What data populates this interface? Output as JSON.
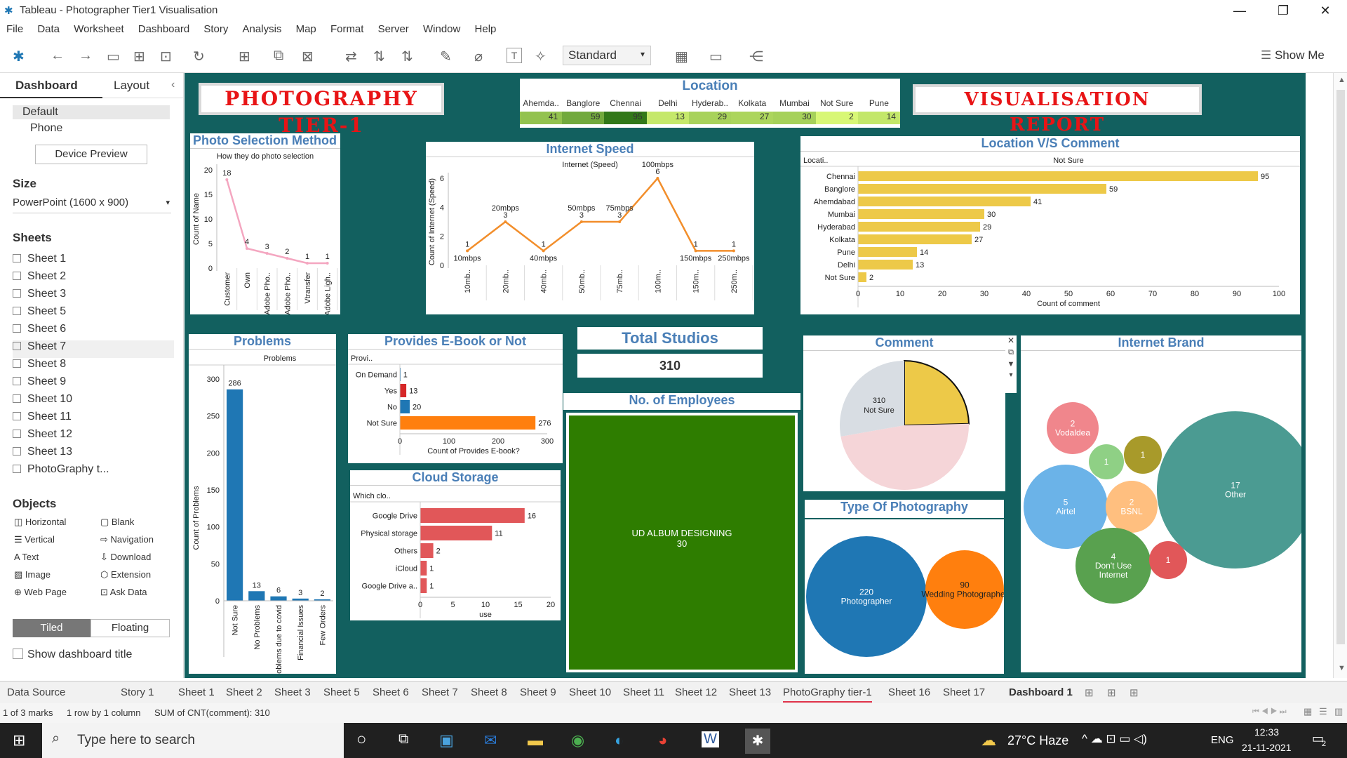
{
  "window": {
    "title": "Tableau - Photographer Tier1 Visualisation",
    "controls": [
      "—",
      "❐",
      "✕"
    ]
  },
  "menu": [
    "File",
    "Data",
    "Worksheet",
    "Dashboard",
    "Story",
    "Analysis",
    "Map",
    "Format",
    "Server",
    "Window",
    "Help"
  ],
  "toolbar": {
    "mode": "Standard",
    "show_me": "Show Me"
  },
  "left": {
    "tab_dashboard": "Dashboard",
    "tab_layout": "Layout",
    "collapse": "‹",
    "devices": [
      "Default",
      "Phone"
    ],
    "device_preview": "Device Preview",
    "size_label": "Size",
    "size_value": "PowerPoint (1600 x 900)",
    "sheets_label": "Sheets",
    "sheets": [
      "Sheet 1",
      "Sheet 2",
      "Sheet 3",
      "Sheet 5",
      "Sheet 6",
      "Sheet 7",
      "Sheet 8",
      "Sheet 9",
      "Sheet 10",
      "Sheet 11",
      "Sheet 12",
      "Sheet 13",
      "PhotoGraphy t..."
    ],
    "objects_label": "Objects",
    "objects": [
      "Horizontal",
      "Blank",
      "Vertical",
      "Navigation",
      "Text",
      "Download",
      "Image",
      "Extension",
      "Web Page",
      "Ask Data"
    ],
    "tiled": "Tiled",
    "floating": "Floating",
    "show_title": "Show dashboard title"
  },
  "dashboard": {
    "banner_left": "PHOTOGRAPHY TIER-1",
    "banner_right": "VISUALISATION REPORT",
    "location": {
      "title": "Location",
      "headers": [
        "Ahemda..",
        "Banglore",
        "Chennai",
        "Delhi",
        "Hyderab..",
        "Kolkata",
        "Mumbai",
        "Not Sure",
        "Pune"
      ],
      "values": [
        "41",
        "59",
        "95",
        "13",
        "29",
        "27",
        "30",
        "2",
        "14"
      ]
    },
    "total_studios": {
      "title": "Total Studios",
      "value": "310"
    },
    "employees": {
      "title": "No. of Employees",
      "label": "UD ALBUM DESIGNING",
      "value": "30"
    },
    "comment_panel": {
      "title": "Comment",
      "label": "Not Sure",
      "value": "310"
    },
    "type_photo": {
      "title": "Type Of Photography",
      "bubbles": [
        {
          "label": "Photographer",
          "value": "220"
        },
        {
          "label": "Wedding Photographer",
          "value": "90"
        }
      ]
    },
    "internet_brand": {
      "title": "Internet Brand",
      "bubbles": [
        {
          "label": "Vodaldea",
          "value": "2"
        },
        {
          "label": "",
          "value": "1"
        },
        {
          "label": "",
          "value": "1"
        },
        {
          "label": "Airtel",
          "value": "5"
        },
        {
          "label": "BSNL",
          "value": "2"
        },
        {
          "label": "Other",
          "value": "17"
        },
        {
          "label": "Don't Use Internet",
          "value": "4"
        },
        {
          "label": "",
          "value": "1"
        }
      ]
    }
  },
  "chart_data": [
    {
      "type": "line",
      "title": "Photo Selection Method",
      "subtitle": "How they do photo selection",
      "ylabel": "Count of Name",
      "ylim": [
        0,
        20
      ],
      "yticks": [
        0,
        5,
        10,
        15,
        20
      ],
      "categories": [
        "Customer",
        "Own",
        "Adobe Pho..",
        "Adobe Pho..",
        "Vtransfer",
        "Adobe Ligh.."
      ],
      "values": [
        18,
        4,
        3,
        2,
        1,
        1
      ],
      "color": "#f4a6c0"
    },
    {
      "type": "line",
      "title": "Internet Speed",
      "subtitle": "Internet (Speed)",
      "ylabel": "Count of Internet (Speed)",
      "ylim": [
        0,
        6
      ],
      "yticks": [
        0,
        2,
        4,
        6
      ],
      "categories": [
        "10mb..",
        "20mb..",
        "40mb..",
        "50mb..",
        "75mb..",
        "100m..",
        "150m..",
        "250m.."
      ],
      "point_labels": [
        "10mbps",
        "20mbps",
        "40mbps",
        "50mbps",
        "75mbps",
        "100mbps",
        "150mbps",
        "250mbps"
      ],
      "values": [
        1,
        3,
        1,
        3,
        3,
        6,
        1,
        1
      ],
      "color": "#f28e2b"
    },
    {
      "type": "bar",
      "orientation": "horizontal",
      "title": "Location V/S Comment",
      "column_header": "Not Sure",
      "row_header": "Locati..",
      "xlabel": "Count of comment",
      "xlim": [
        0,
        100
      ],
      "xticks": [
        0,
        10,
        20,
        30,
        40,
        50,
        60,
        70,
        80,
        90,
        100
      ],
      "categories": [
        "Chennai",
        "Banglore",
        "Ahemdabad",
        "Mumbai",
        "Hyderabad",
        "Kolkata",
        "Pune",
        "Delhi",
        "Not Sure"
      ],
      "values": [
        95,
        59,
        41,
        30,
        29,
        27,
        14,
        13,
        2
      ],
      "color": "#edc948"
    },
    {
      "type": "bar",
      "title": "Problems",
      "column_header": "Problems",
      "ylabel": "Count of Problems",
      "ylim": [
        0,
        300
      ],
      "yticks": [
        0,
        50,
        100,
        150,
        200,
        250,
        300
      ],
      "categories": [
        "Not Sure",
        "No Problems",
        "Problems due to covid",
        "Financial Issues",
        "Few Orders"
      ],
      "values": [
        286,
        13,
        6,
        3,
        2
      ],
      "color": "#1f77b4"
    },
    {
      "type": "bar",
      "orientation": "horizontal",
      "title": "Provides E-Book or Not",
      "row_header": "Provi..",
      "xlabel": "Count of Provides E-book?",
      "xlim": [
        0,
        300
      ],
      "xticks": [
        0,
        100,
        200,
        300
      ],
      "categories": [
        "On Demand",
        "Yes",
        "No",
        "Not Sure"
      ],
      "values": [
        1,
        13,
        20,
        276
      ],
      "colors": [
        "#1f77b4",
        "#d62728",
        "#1f77b4",
        "#ff7f0e"
      ]
    },
    {
      "type": "bar",
      "orientation": "horizontal",
      "title": "Cloud Storage",
      "row_header": "Which clo..",
      "xlabel": "use",
      "xlim": [
        0,
        20
      ],
      "xticks": [
        0,
        5,
        10,
        15,
        20
      ],
      "categories": [
        "Google Drive",
        "Physical storage",
        "Others",
        "iCloud",
        "Google Drive a.."
      ],
      "values": [
        16,
        11,
        2,
        1,
        1
      ],
      "color": "#e15759"
    },
    {
      "type": "pie",
      "title": "Comment",
      "categories": [
        "Not Sure",
        "",
        ""
      ],
      "values": [
        310,
        600,
        350
      ],
      "colors": [
        "#edc948",
        "#f5d5d8",
        "#d8dde3"
      ]
    }
  ],
  "bottom_tabs": [
    "Data Source",
    "Story 1",
    "Sheet 1",
    "Sheet 2",
    "Sheet 3",
    "Sheet 5",
    "Sheet 6",
    "Sheet 7",
    "Sheet 8",
    "Sheet 9",
    "Sheet 10",
    "Sheet 11",
    "Sheet 12",
    "Sheet 13",
    "PhotoGraphy tier-1",
    "Sheet 16",
    "Sheet 17",
    "Dashboard 1"
  ],
  "status": {
    "marks": "1 of 3 marks",
    "rows": "1 row by 1 column",
    "sum": "SUM of CNT(comment): 310"
  },
  "taskbar": {
    "search": "Type here to search",
    "weather": "27°C  Haze",
    "lang": "ENG",
    "time": "12:33",
    "date": "21-11-2021",
    "notif": "2"
  }
}
